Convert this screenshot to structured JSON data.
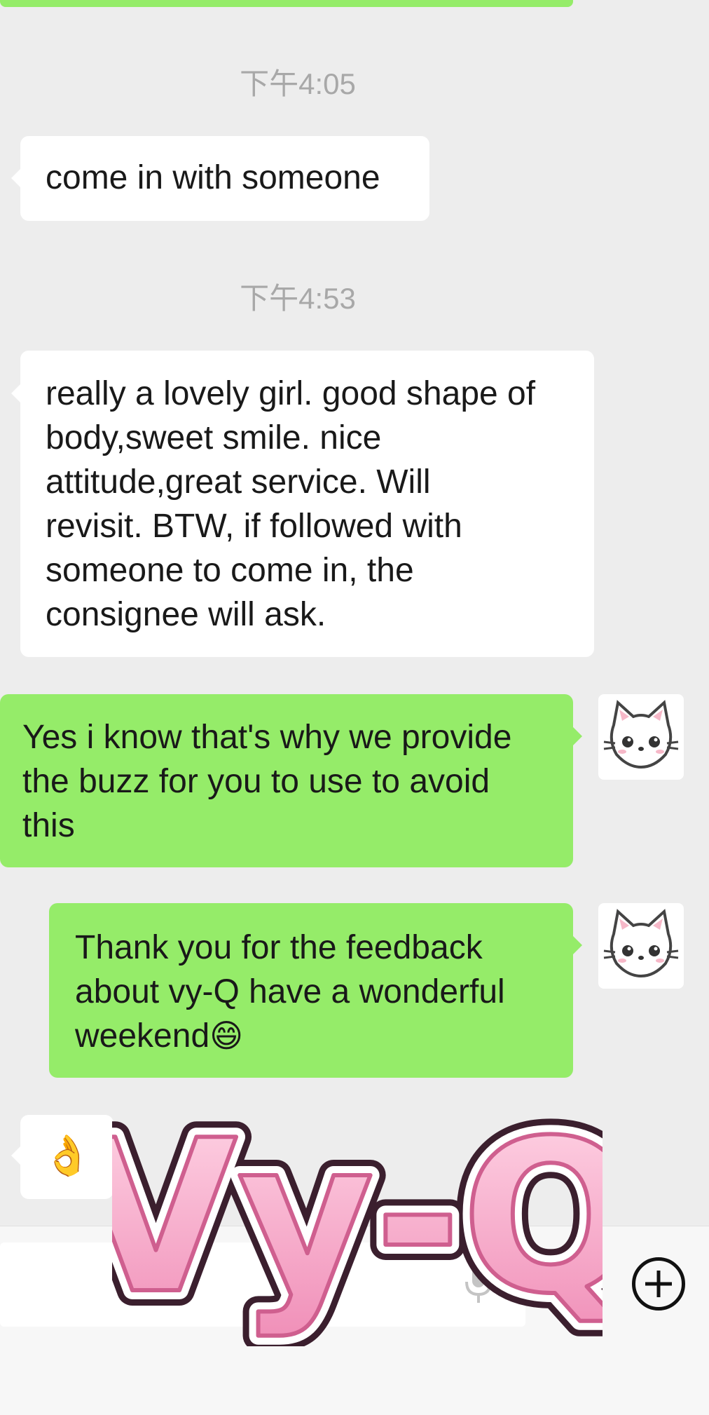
{
  "chat": {
    "messages": [
      {
        "type": "time",
        "text": "下午4:05"
      },
      {
        "type": "in",
        "text": "come in with someone"
      },
      {
        "type": "time",
        "text": "下午4:53"
      },
      {
        "type": "in",
        "lines": [
          "really a lovely girl. good shape of",
          "body,sweet smile. nice",
          "attitude,great service. Will",
          "revisit. BTW, if followed with",
          "someone to come in, the",
          "consignee will ask."
        ]
      },
      {
        "type": "out",
        "lines": [
          "Yes i know that's why we provide",
          "the buzz for you to use to avoid",
          "this"
        ]
      },
      {
        "type": "out",
        "lines": [
          "Thank you for the feedback",
          "about vy-Q have a wonderful",
          "weekend"
        ],
        "emoji": "😄"
      },
      {
        "type": "in",
        "emoji": "👌"
      }
    ]
  },
  "watermark": {
    "text": "Vy-Q",
    "fill": "#f7b6d0",
    "stroke": "#cf5f8f",
    "outline": "#3b1f2e"
  },
  "input_bar": {
    "voice_icon": "microphone-icon",
    "emoji_icon": "smiley-icon",
    "plus_icon": "plus-circle-icon"
  },
  "colors": {
    "background": "#ededed",
    "incoming": "#ffffff",
    "outgoing": "#95ec69",
    "timestamp": "#a8a8a8"
  }
}
